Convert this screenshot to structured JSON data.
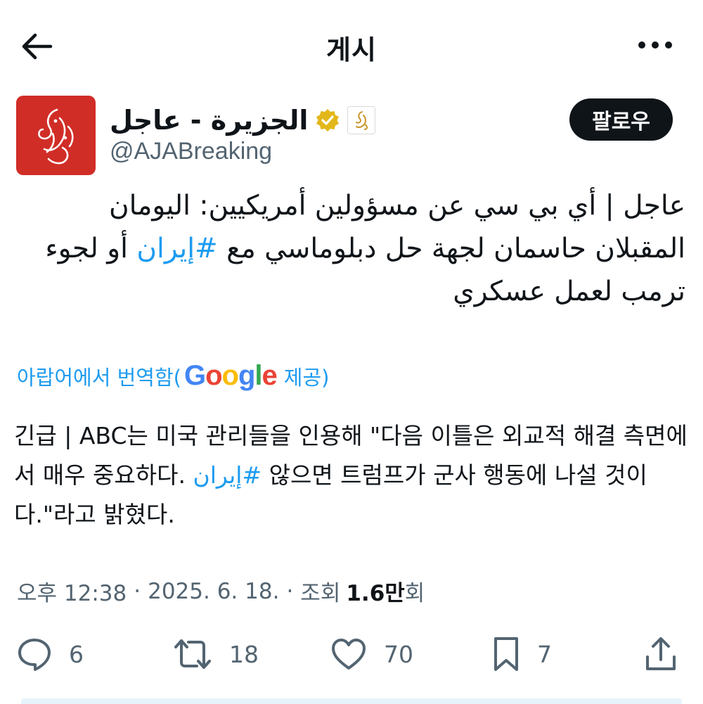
{
  "header": {
    "title": "게시",
    "back_icon": "arrow-left-icon",
    "more_icon": "more-dots-icon"
  },
  "author": {
    "display_name": "الجزيرة - عاجل",
    "handle": "@AJABreaking",
    "verified_color": "#e2b719",
    "avatar_color": "#d12d27",
    "follow_label": "팔로우"
  },
  "post": {
    "original_text_before": "عاجل | أي بي سي عن مسؤولين أمريكيين: اليومان المقبلان حاسمان لجهة حل دبلوماسي مع ",
    "original_hashtag": "#إيران",
    "original_text_after": " أو لجوء ترمب لعمل عسكري",
    "translated_by_prefix": "아랍어에서 번역함(",
    "translated_by_suffix": " 제공)",
    "google": {
      "g": "G",
      "o1": "o",
      "o2": "o",
      "g2": "g",
      "l": "l",
      "e": "e"
    },
    "translated_text_before": "긴급 | ABC는 미국 관리들을 인용해 \"다음 이틀은 외교적 해결 측면에서 매우 중요하다. ",
    "translated_hashtag": "إيران#",
    "translated_text_after": " 않으면 트럼프가 군사 행동에 나설 것이다.\"라고 밝혔다."
  },
  "meta": {
    "time": "오후 12:38",
    "separator": "·",
    "date": "2025. 6. 18.",
    "separator2": "·",
    "views_label": "조회",
    "views_count": "1.6만",
    "views_suffix": "회"
  },
  "actions": {
    "replies": "6",
    "reposts": "18",
    "likes": "70",
    "bookmarks": "7"
  }
}
